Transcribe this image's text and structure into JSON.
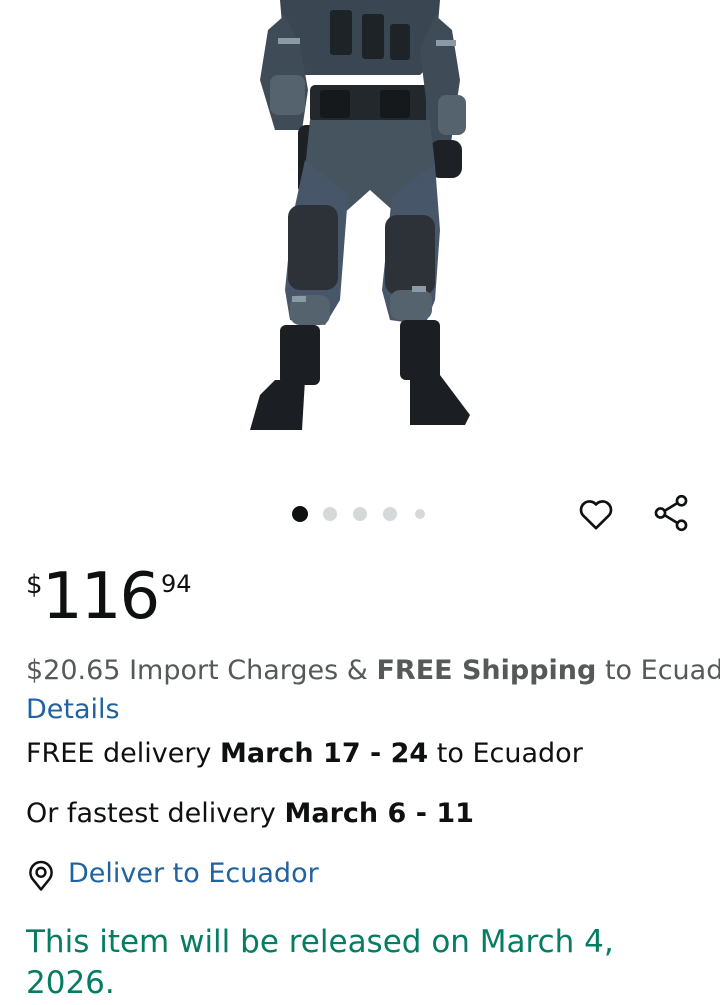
{
  "carousel": {
    "count": 5,
    "active_index": 0
  },
  "actions": {
    "wishlist_icon": "heart-outline-icon",
    "share_icon": "share-icon"
  },
  "price": {
    "symbol": "$",
    "whole": "116",
    "fraction": "94"
  },
  "import_charges": {
    "amount": "$20.65",
    "text": "Import Charges &",
    "shipping_bold": "FREE Shipping",
    "destination": "to Ecuador"
  },
  "details_link": "Details",
  "delivery": {
    "prefix": "FREE delivery",
    "dates": "March 17 - 24",
    "suffix": "to Ecuador"
  },
  "fastest_delivery": {
    "prefix": "Or fastest delivery",
    "dates": "March 6 - 11"
  },
  "deliver_to": {
    "icon": "location-pin-icon",
    "label": "Deliver to Ecuador"
  },
  "release_notice": "This item will be released on March 4, 2026.",
  "colors": {
    "link": "#2162a1",
    "release_green": "#067d62",
    "muted_text": "#565959"
  }
}
